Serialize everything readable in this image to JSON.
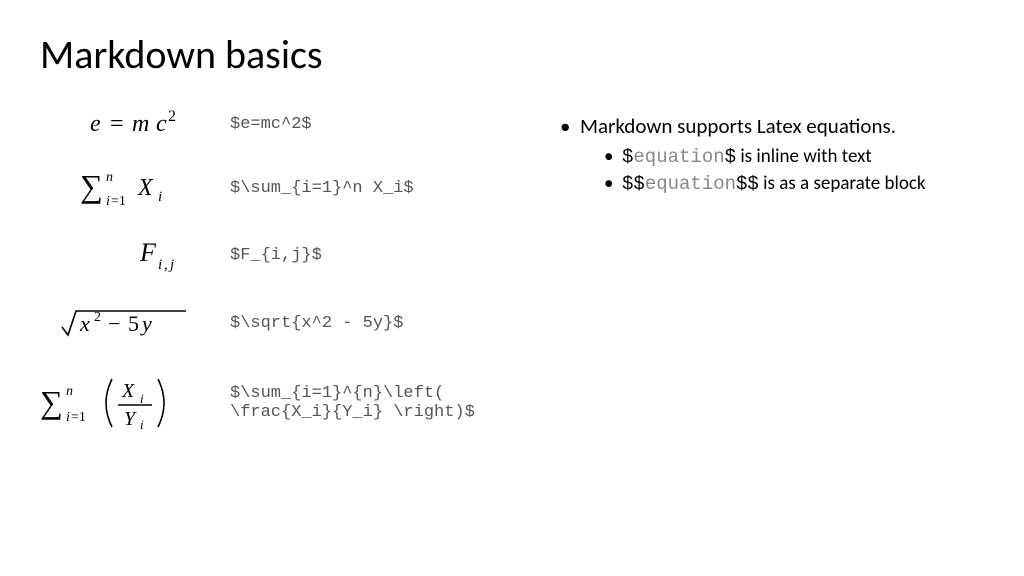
{
  "title": "Markdown basics",
  "examples": [
    {
      "code": "$e=mc^2$"
    },
    {
      "code": "$\\sum_{i=1}^n X_i$"
    },
    {
      "code": "$F_{i,j}$"
    },
    {
      "code": "$\\sqrt{x^2 - 5y}$"
    },
    {
      "code": "$\\sum_{i=1}^{n}\\left( \\frac{X_i}{Y_i} \\right)$"
    }
  ],
  "bullets": {
    "main": "Markdown supports Latex equations.",
    "sub1": {
      "d1": "$",
      "eq": "equation",
      "d2": "$",
      "rest": "  is inline with text"
    },
    "sub2": {
      "d1": "$$",
      "eq": "equation",
      "d2": "$$",
      "rest": "  is as a separate block"
    }
  }
}
